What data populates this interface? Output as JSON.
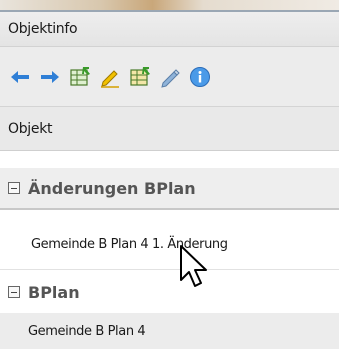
{
  "panel": {
    "title": "Objektinfo",
    "column_header": "Objekt"
  },
  "toolbar": {
    "icons": [
      "arrow-left-icon",
      "arrow-right-icon",
      "table-export-icon",
      "pencil-yellow-icon",
      "table-export-icon-2",
      "pencil-icon",
      "info-icon"
    ]
  },
  "tree": {
    "groups": [
      {
        "label": "Änderungen BPlan",
        "items": [
          "Gemeinde B Plan 4 1. Änderung"
        ]
      },
      {
        "label": "BPlan",
        "items": [
          "Gemeinde B Plan 4"
        ]
      }
    ]
  },
  "colors": {
    "accent_blue": "#2f7fd6",
    "info_blue": "#4a9ae8",
    "pencil_yellow": "#f2c100"
  }
}
